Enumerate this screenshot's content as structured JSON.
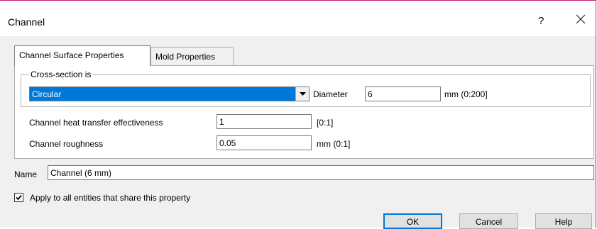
{
  "window": {
    "title": "Channel",
    "help_glyph": "?",
    "close_glyph": "close"
  },
  "tabs": [
    {
      "label": "Channel Surface Properties",
      "active": true
    },
    {
      "label": "Mold Properties",
      "active": false
    }
  ],
  "cross_section": {
    "legend": "Cross-section is",
    "selected": "Circular",
    "diameter_label": "Diameter",
    "diameter_value": "6",
    "diameter_range": "mm (0:200]"
  },
  "heat_transfer": {
    "label": "Channel heat transfer effectiveness",
    "value": "1",
    "range": "[0:1]"
  },
  "roughness": {
    "label": "Channel roughness",
    "value": "0.05",
    "range": "mm (0:1]"
  },
  "name_field": {
    "label": "Name",
    "value": "Channel (6 mm)"
  },
  "apply_all": {
    "label": "Apply to all entities that share this property",
    "checked": true
  },
  "buttons": {
    "ok": "OK",
    "cancel": "Cancel",
    "help": "Help"
  },
  "colors": {
    "selection": "#0078d7",
    "window_border": "#c0206e"
  }
}
